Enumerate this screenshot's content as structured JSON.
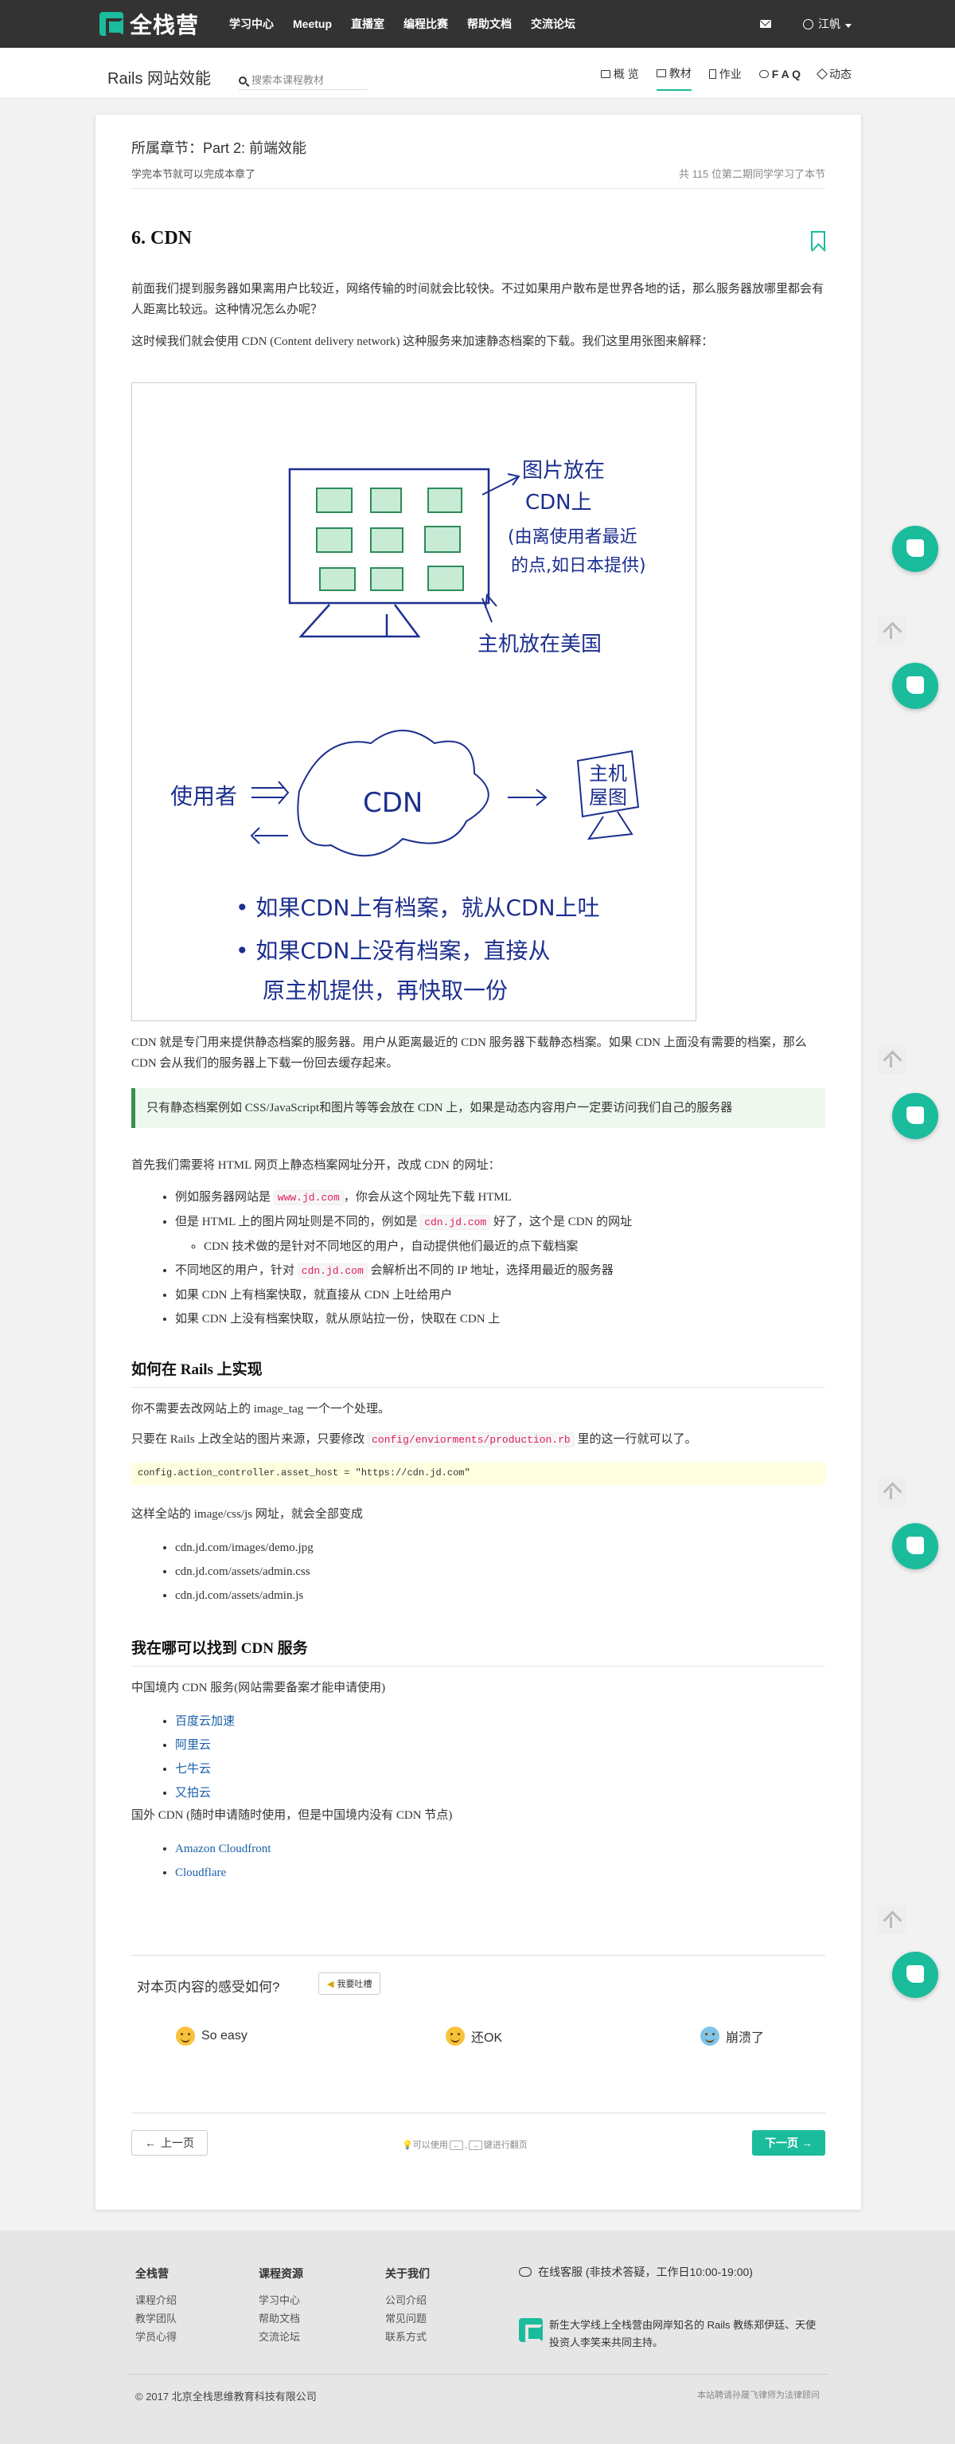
{
  "nav": {
    "brand": "全栈营",
    "links": [
      "学习中心",
      "Meetup",
      "直播室",
      "编程比赛",
      "帮助文档",
      "交流论坛"
    ],
    "user": "江帆"
  },
  "subheader": {
    "course_title": "Rails 网站效能",
    "search_placeholder": "搜索本课程教材",
    "tabs": [
      {
        "label": "概 览",
        "active": false
      },
      {
        "label": "教材",
        "active": true
      },
      {
        "label": "作业",
        "active": false
      },
      {
        "label": "F A Q",
        "active": false
      },
      {
        "label": "动态",
        "active": false
      }
    ]
  },
  "chapter": {
    "label": "所属章节：Part 2: 前端效能",
    "note": "学完本节就可以完成本章了",
    "learners": "共 115 位第二期同学学习了本节"
  },
  "article": {
    "title": "6. CDN",
    "p1": "前面我们提到服务器如果离用户比较近，网络传输的时间就会比较快。不过如果用户散布是世界各地的话，那么服务器放哪里都会有人距离比较远。这种情况怎么办呢？",
    "p2": "这时候我们就会使用 CDN (Content delivery network) 这种服务来加速静态档案的下载。我们这里用张图来解释：",
    "figure": {
      "note_image": "图片放在",
      "note_cdn": "CDN上",
      "note_paren1": "(由离使用者最近",
      "note_paren2": "的点,如日本提供)",
      "note_host": "主机放在美国",
      "user_label": "使用者",
      "cdn_label": "CDN",
      "host_box1": "主机",
      "host_box2": "屋图",
      "bullet1": "• 如果CDN上有档案，就从CDN上吐",
      "bullet2a": "• 如果CDN上没有档案，直接从",
      "bullet2b": "原主机提供，再快取一份"
    },
    "p3": "CDN 就是专门用来提供静态档案的服务器。用户从距离最近的 CDN 服务器下载静态档案。如果 CDN 上面没有需要的档案，那么 CDN 会从我们的服务器上下载一份回去缓存起来。",
    "callout": "只有静态档案例如 CSS/JavaScript和图片等等会放在 CDN 上，如果是动态内容用户一定要访问我们自己的服务器",
    "p4": "首先我们需要将 HTML 网页上静态档案网址分开，改成 CDN 的网址：",
    "list1": {
      "i1_pre": "例如服务器网站是 ",
      "i1_code": "www.jd.com",
      "i1_post": "，你会从这个网址先下载 HTML",
      "i2_pre": "但是 HTML 上的图片网址则是不同的，例如是 ",
      "i2_code": "cdn.jd.com",
      "i2_post": " 好了，这个是 CDN 的网址",
      "i2_sub": "CDN 技术做的是针对不同地区的用户，自动提供他们最近的点下载档案",
      "i3_pre": "不同地区的用户，针对 ",
      "i3_code": "cdn.jd.com",
      "i3_post": " 会解析出不同的 IP 地址，选择用最近的服务器",
      "i4": "如果 CDN 上有档案快取，就直接从 CDN 上吐给用户",
      "i5": "如果 CDN 上没有档案快取，就从原站拉一份，快取在 CDN 上"
    },
    "h_rails": "如何在 Rails 上实现",
    "p5": "你不需要去改网站上的 image_tag 一个一个处理。",
    "p6_pre": "只要在 Rails 上改全站的图片来源，只要修改 ",
    "p6_code": "config/enviorments/production.rb",
    "p6_post": " 里的这一行就可以了。",
    "code": "config.action_controller.asset_host = \"https://cdn.jd.com\"",
    "p7": "这样全站的 image/css/js 网址，就会全部变成",
    "list2": [
      "cdn.jd.com/images/demo.jpg",
      "cdn.jd.com/assets/admin.css",
      "cdn.jd.com/assets/admin.js"
    ],
    "h_where": "我在哪可以找到 CDN 服务",
    "p8": "中国境内 CDN 服务(网站需要备案才能申请使用)",
    "list3": [
      "百度云加速",
      "阿里云",
      "七牛云",
      "又拍云"
    ],
    "p9": "国外 CDN (随时申请随时使用，但是中国境内没有 CDN 节点)",
    "list4": [
      "Amazon Cloudfront",
      "Cloudflare"
    ]
  },
  "feedback": {
    "question": "对本页内容的感受如何?",
    "complain": "我要吐槽",
    "reactions": [
      "So easy",
      "还OK",
      "崩溃了"
    ]
  },
  "pager": {
    "prev": "上一页",
    "hint_pre": "可以使用",
    "key_left": "←",
    "key_right": "→",
    "hint_post": "键进行翻页",
    "next": "下一页"
  },
  "footer": {
    "col1": {
      "title": "全栈营",
      "items": [
        "课程介绍",
        "教学团队",
        "学员心得"
      ]
    },
    "col2": {
      "title": "课程资源",
      "items": [
        "学习中心",
        "帮助文档",
        "交流论坛"
      ]
    },
    "col3": {
      "title": "关于我们",
      "items": [
        "公司介绍",
        "常见问题",
        "联系方式"
      ]
    },
    "service": "在线客服 (非技术答疑，工作日10:00-19:00)",
    "intro": "新生大学线上全栈营由网岸知名的 Rails 教练郑伊廷、天使投资人李笑来共同主持。",
    "copyright": "© 2017 北京全栈思维教育科技有限公司",
    "legal": "本站聘请孙晟飞律师为法律顾问"
  },
  "colors": {
    "accent": "#1abc9c",
    "nav_bg": "#333333",
    "callout_border": "#3c8f4c",
    "link": "#1a5faa",
    "code_red": "#e01e5a"
  }
}
